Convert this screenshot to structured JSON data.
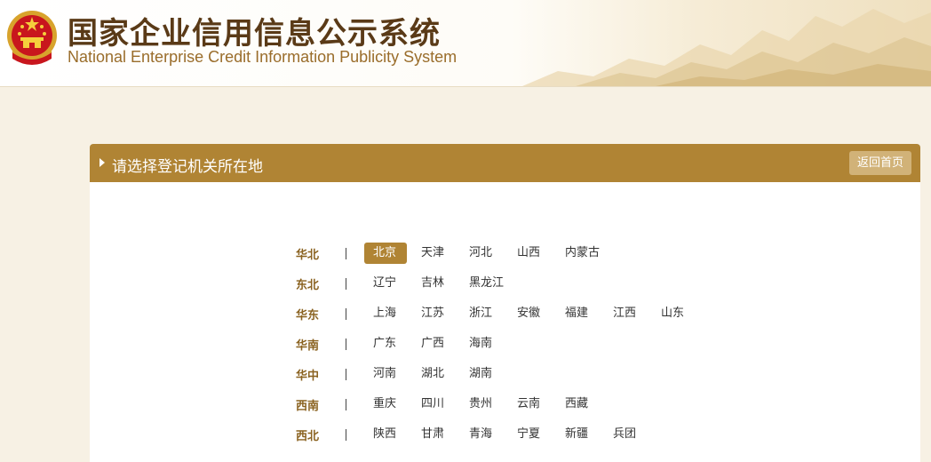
{
  "header": {
    "title_cn": "国家企业信用信息公示系统",
    "title_en": "National Enterprise Credit Information Publicity System"
  },
  "panel": {
    "title": "请选择登记机关所在地",
    "home_button": "返回首页"
  },
  "regions": [
    {
      "name": "华北",
      "provinces": [
        "北京",
        "天津",
        "河北",
        "山西",
        "内蒙古"
      ]
    },
    {
      "name": "东北",
      "provinces": [
        "辽宁",
        "吉林",
        "黑龙江"
      ]
    },
    {
      "name": "华东",
      "provinces": [
        "上海",
        "江苏",
        "浙江",
        "安徽",
        "福建",
        "江西",
        "山东"
      ]
    },
    {
      "name": "华南",
      "provinces": [
        "广东",
        "广西",
        "海南"
      ]
    },
    {
      "name": "华中",
      "provinces": [
        "河南",
        "湖北",
        "湖南"
      ]
    },
    {
      "name": "西南",
      "provinces": [
        "重庆",
        "四川",
        "贵州",
        "云南",
        "西藏"
      ]
    },
    {
      "name": "西北",
      "provinces": [
        "陕西",
        "甘肃",
        "青海",
        "宁夏",
        "新疆",
        "兵团"
      ]
    }
  ],
  "selected_province": "北京",
  "colors": {
    "accent": "#b08434",
    "region_label": "#8a6220",
    "background": "#f7f1e4"
  }
}
